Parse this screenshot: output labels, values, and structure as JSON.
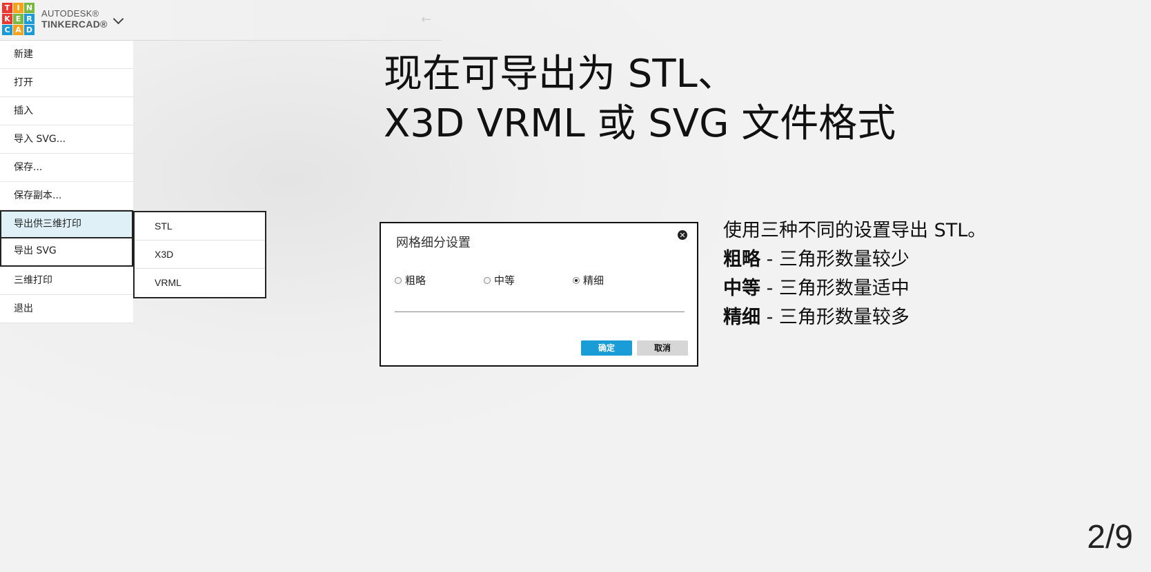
{
  "logo": {
    "letters": [
      "T",
      "I",
      "N",
      "K",
      "E",
      "R",
      "C",
      "A",
      "D"
    ],
    "colors": [
      "#e8382f",
      "#f5a21b",
      "#7ab93f",
      "#e8382f",
      "#7ab93f",
      "#1c9ad6",
      "#1c9ad6",
      "#f5a21b",
      "#1c9ad6"
    ],
    "brand_top": "AUTODESK®",
    "brand_bottom": "TINKERCAD®"
  },
  "menu": {
    "items": [
      {
        "label": "新建"
      },
      {
        "label": "打开"
      },
      {
        "label": "插入"
      },
      {
        "label": "导入 SVG..."
      },
      {
        "label": "保存..."
      },
      {
        "label": "保存副本..."
      },
      {
        "label": "导出供三维打印"
      },
      {
        "label": "导出 SVG"
      },
      {
        "label": "三维打印"
      },
      {
        "label": "退出"
      }
    ]
  },
  "submenu": {
    "items": [
      {
        "label": "STL"
      },
      {
        "label": "X3D"
      },
      {
        "label": "VRML"
      }
    ]
  },
  "headline": {
    "line1": "现在可导出为 STL、",
    "line2": "X3D VRML 或 SVG 文件格式"
  },
  "dialog": {
    "title": "网格细分设置",
    "options": [
      {
        "label": "粗略",
        "selected": false
      },
      {
        "label": "中等",
        "selected": false
      },
      {
        "label": "精细",
        "selected": true
      }
    ],
    "ok_label": "确定",
    "cancel_label": "取消",
    "accent": "#1a9cd6"
  },
  "info": {
    "intro": "使用三种不同的设置导出 STL。",
    "rows": [
      {
        "term": "粗略",
        "desc": " - 三角形数量较少"
      },
      {
        "term": "中等",
        "desc": " - 三角形数量适中"
      },
      {
        "term": "精细",
        "desc": " - 三角形数量较多"
      }
    ]
  },
  "page_indicator": "2/9"
}
